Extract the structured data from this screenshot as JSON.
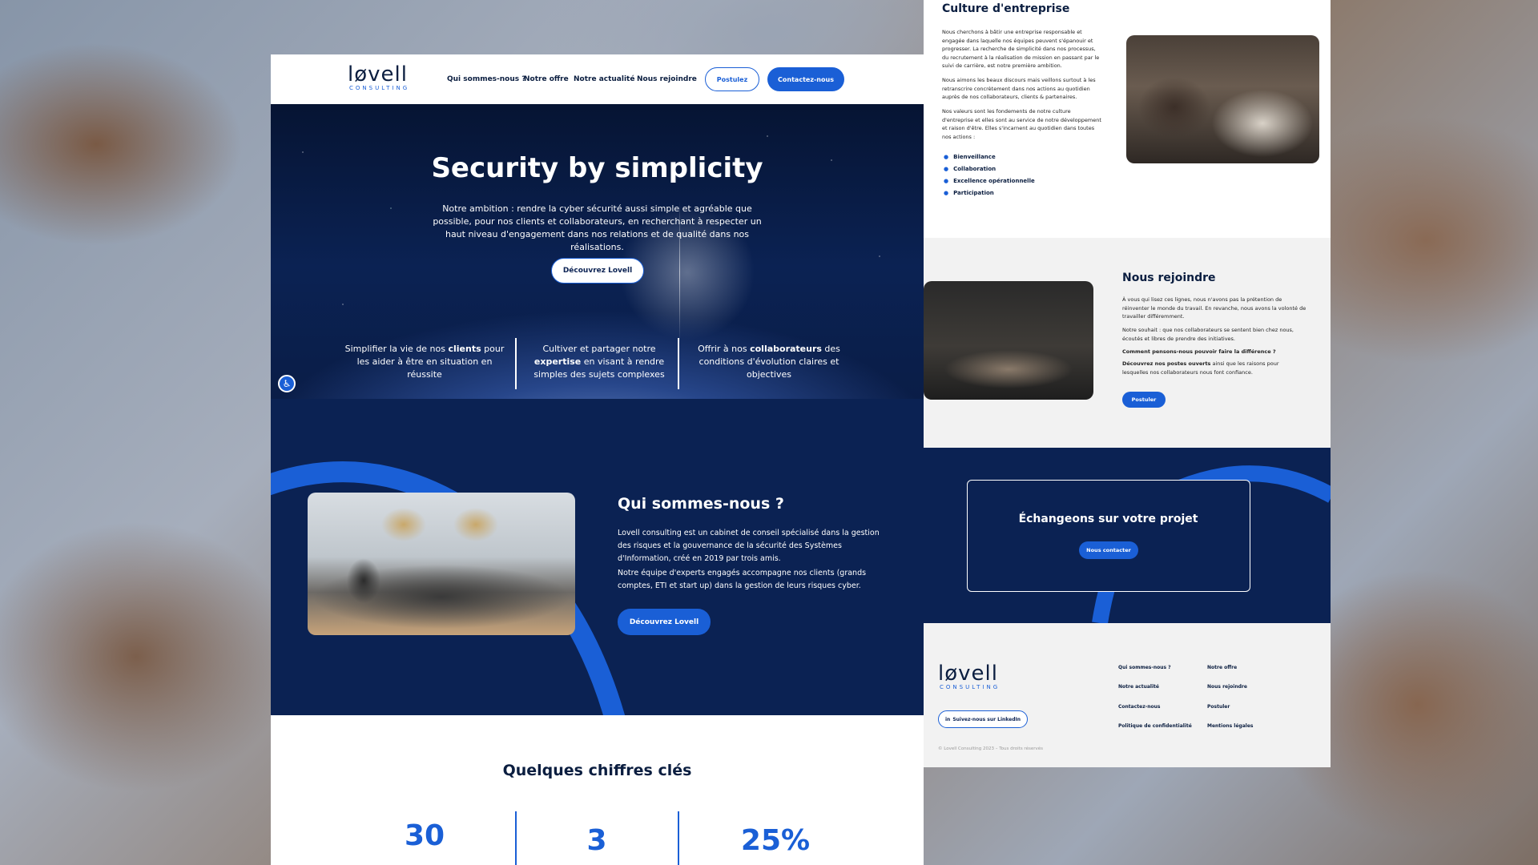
{
  "nav": {
    "logo_word": "løvell",
    "logo_sub": "CONSULTING",
    "links": [
      "Qui sommes-nous ?",
      "Notre offre",
      "Notre actualité",
      "Nous rejoindre"
    ],
    "postulez": "Postulez",
    "contact": "Contactez-nous"
  },
  "hero": {
    "title": "Security by simplicity",
    "text": "Notre ambition : rendre la cyber sécurité aussi simple et agréable que possible, pour nos clients et collaborateurs, en recherchant à respecter un haut niveau d'engagement dans nos relations et de qualité dans nos réalisations.",
    "cta": "Découvrez Lovell",
    "pillars": [
      {
        "pre": "Simplifier la vie de nos ",
        "bold": "clients",
        "post": " pour les aider à être en situation en réussite"
      },
      {
        "pre": "Cultiver et partager notre ",
        "bold": "expertise",
        "post": " en visant à rendre simples des sujets complexes"
      },
      {
        "pre": "Offrir à nos ",
        "bold": "collaborateurs",
        "post": " des conditions d'évolution claires et objectives"
      }
    ]
  },
  "about": {
    "title": "Qui sommes-nous ?",
    "p1": "Lovell consulting est un cabinet de conseil spécialisé dans la gestion des risques et la gouvernance de la sécurité des Systèmes d'Information, créé en 2019 par trois amis.",
    "p2": "Notre équipe d'experts engagés accompagne nos clients (grands comptes, ETI et start up) dans la gestion de leurs risques cyber.",
    "cta": "Découvrez Lovell"
  },
  "stats": {
    "title": "Quelques chiffres clés",
    "values": [
      "30",
      "3",
      "25%"
    ]
  },
  "culture": {
    "title": "Culture d'entreprise",
    "p1": "Nous cherchons à bâtir une entreprise responsable et engagée dans laquelle nos équipes peuvent s'épanouir et progresser. La recherche de simplicité dans nos processus, du recrutement à la réalisation de mission en passant par le suivi de carrière, est notre première ambition.",
    "p2": "Nous aimons les beaux discours mais veillons surtout à les retranscrire concrètement dans nos actions au quotidien auprès de nos collaborateurs, clients & partenaires.",
    "p3": "Nos valeurs sont les fondements de notre culture d'entreprise et elles sont au service de notre développement et raison d'être. Elles s'incarnent au quotidien dans toutes nos actions :",
    "values": [
      "Bienveillance",
      "Collaboration",
      "Excellence opérationnelle",
      "Participation"
    ]
  },
  "join": {
    "title": "Nous rejoindre",
    "p1": "À vous qui lisez ces lignes, nous n'avons pas la prétention de réinventer le monde du travail. En revanche, nous avons la volonté de travailler différemment.",
    "p2": "Notre souhait : que nos collaborateurs se sentent bien chez nous, écoutés et libres de prendre des initiatives.",
    "p3": "Comment pensons-nous pouvoir faire la différence ?",
    "p4_bold": "Découvrez nos postes ouverts",
    "p4_rest": " ainsi que les raisons pour lesquelles nos collaborateurs nous font confiance.",
    "cta": "Postuler"
  },
  "project": {
    "title": "Échangeons sur votre projet",
    "cta": "Nous contacter"
  },
  "footer": {
    "logo_word": "løvell",
    "logo_sub": "CONSULTING",
    "linkedin": "Suivez-nous sur LinkedIn",
    "linkedin_icon": "in",
    "links": [
      "Qui sommes-nous ?",
      "Notre offre",
      "Notre actualité",
      "Nous rejoindre",
      "Contactez-nous",
      "Postuler",
      "Politique de confidentialité",
      "Mentions légales"
    ],
    "copyright": "© Lovell Consulting 2023 – Tous droits réservés"
  },
  "colors": {
    "navy": "#0b2253",
    "blue": "#1a5fd6"
  }
}
